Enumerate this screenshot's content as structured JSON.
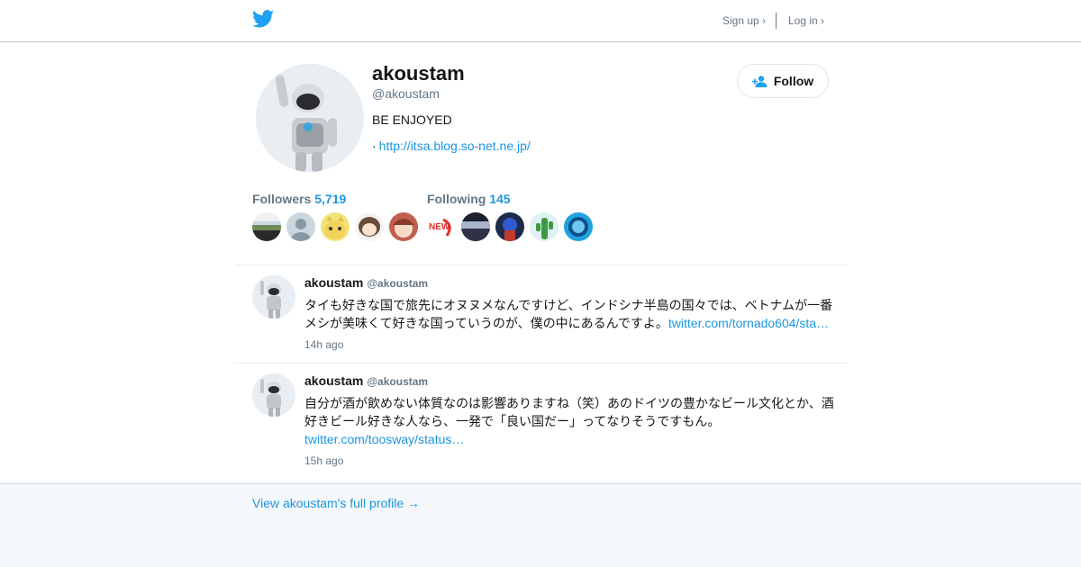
{
  "nav": {
    "signup": "Sign up ›",
    "login": "Log in ›"
  },
  "profile": {
    "name": "akoustam",
    "handle": "@akoustam",
    "bio": "BE ENJOYED",
    "url_prefix": "·",
    "url": "http://itsa.blog.so-net.ne.jp/",
    "follow_label": "Follow"
  },
  "stats": {
    "followers_label": "Followers",
    "followers_count": "5,719",
    "following_label": "Following",
    "following_count": "145"
  },
  "tweets": [
    {
      "name": "akoustam",
      "handle": "@akoustam",
      "text": "タイも好きな国で旅先にオヌヌメなんですけど、インドシナ半島の国々では、ベトナムが一番メシが美味くて好きな国っていうのが、僕の中にあるんですよ。",
      "link": "twitter.com/tornado604/sta…",
      "time": "14h ago"
    },
    {
      "name": "akoustam",
      "handle": "@akoustam",
      "text": "自分が酒が飲めない体質なのは影響ありますね（笑）あのドイツの豊かなビール文化とか、酒好きビール好きな人なら、一発で「良い国だー」ってなりそうですもん。",
      "link": "twitter.com/toosway/status…",
      "time": "15h ago"
    }
  ],
  "footer": {
    "full_profile": "View akoustam's full profile →"
  },
  "colors": {
    "accent": "#1b95e0",
    "muted": "#657786",
    "footer_bg": "#f5f8fa"
  },
  "icons": [
    "twitter-bird-icon",
    "add-user-icon"
  ]
}
